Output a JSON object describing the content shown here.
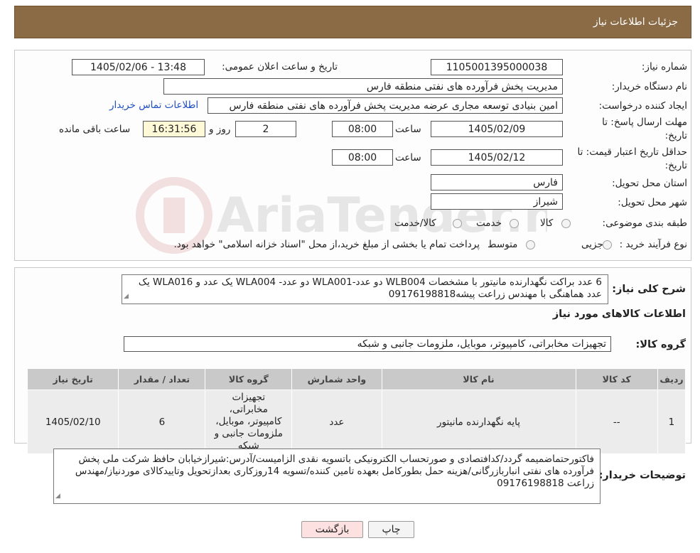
{
  "header": {
    "title": "جزئیات اطلاعات نیاز"
  },
  "form": {
    "need_number_label": "شماره نیاز:",
    "need_number": "1105001395000038",
    "announce_label": "تاریخ و ساعت اعلان عمومی:",
    "announce_value": "1405/02/06 - 13:48",
    "buyer_org_label": "نام دستگاه خریدار:",
    "buyer_org": "مدیریت پخش فرآورده های نفتی منطقه فارس",
    "creator_label": "ایجاد کننده درخواست:",
    "creator": "امین بنیادی توسعه مجاری عرضه مدیریت پخش فرآورده های نفتی منطقه فارس",
    "contact_link": "اطلاعات تماس خریدار",
    "deadline_label": "مهلت ارسال پاسخ: تا تاریخ:",
    "deadline_date": "1405/02/09",
    "time_label": "ساعت",
    "deadline_time": "08:00",
    "days_value": "2",
    "days_label": "روز و",
    "remaining_time": "16:31:56",
    "remaining_label": "ساعت باقی مانده",
    "price_validity_label": "حداقل تاریخ اعتبار قیمت: تا تاریخ:",
    "price_validity_date": "1405/02/12",
    "price_validity_time": "08:00",
    "province_label": "استان محل تحویل:",
    "province": "فارس",
    "city_label": "شهر محل تحویل:",
    "city": "شیراز",
    "category_label": "طبقه بندی موضوعی:",
    "category_options": [
      "کالا",
      "خدمت",
      "کالا/خدمت"
    ],
    "process_label": "نوع فرآیند خرید :",
    "process_options": [
      "جزیی",
      "متوسط"
    ],
    "process_note": "پرداخت تمام یا بخشی از مبلغ خرید،از محل \"اسناد خزانه اسلامی\" خواهد بود."
  },
  "summary": {
    "label": "شرح کلی نیاز:",
    "text": "6 عدد براکت نگهدارنده مانیتور با مشخصات WLB004 دو عدد-WLA001 دو عدد- WLA004 یک عدد و WLA016 یک عدد هماهنگی با مهندس زراعت پیشه09176198818",
    "goods_info_title": "اطلاعات کالاهای مورد نیاز",
    "goods_group_label": "گروه کالا:",
    "goods_group": "تجهیزات مخابراتی، کامپیوتر، موبایل، ملزومات جانبی و شبکه"
  },
  "table": {
    "headers": [
      "ردیف",
      "کد کالا",
      "نام کالا",
      "واحد شمارش",
      "گروه کالا",
      "تعداد / مقدار",
      "تاریخ نیاز"
    ],
    "rows": [
      {
        "row": "1",
        "code": "--",
        "name": "پایه نگهدارنده مانیتور",
        "unit": "عدد",
        "group": "تجهیزات مخابراتی، کامپیوتر، موبایل، ملزومات جانبی و شبکه",
        "qty": "6",
        "date": "1405/02/10"
      }
    ]
  },
  "buyer_notes": {
    "label": "توضیحات خریدار:",
    "text": "فاکتورحتماضمیمه گردد/کدافتصادی و صورتحساب الکترونیکی باتسویه نقدی الزامیست/آدرس:شیرازخیابان حافظ شرکت ملی پخش فرآورده های نفتی انباربازرگانی/هزینه حمل بطورکامل بعهده تامین کننده/تسویه 14روزکاری بعدازتحویل وتاییدکالای موردنیاز/مهندس زراعت 09176198818"
  },
  "buttons": {
    "print": "چاپ",
    "back": "بازگشت"
  },
  "colors": {
    "header_bg": "#8b6b45",
    "link": "#1f4fbf",
    "back_bg": "#fde0e0",
    "remaining_bg": "#fff9d8"
  }
}
